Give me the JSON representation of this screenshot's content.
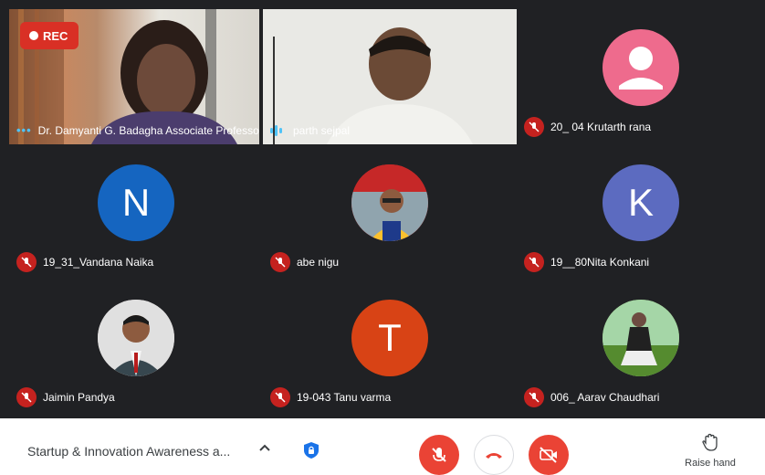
{
  "recording": {
    "label": "REC"
  },
  "tiles": [
    {
      "name": "Dr. Damyanti G. Badagha Associate Professor",
      "state": "speaking-dots"
    },
    {
      "name": "parth sejpal",
      "state": "speaking-bars"
    },
    {
      "name": "20_ 04 Krutarth rana",
      "state": "muted",
      "avatar": "person-icon",
      "avatar_color": "#ee6b8d"
    },
    {
      "name": "19_31_Vandana Naika",
      "state": "muted",
      "avatar_letter": "N",
      "avatar_color": "#1565c0"
    },
    {
      "name": "abe nigu",
      "state": "muted",
      "avatar": "photo"
    },
    {
      "name": "19__80Nita Konkani",
      "state": "muted",
      "avatar_letter": "K",
      "avatar_color": "#5c6bc0"
    },
    {
      "name": "Jaimin Pandya",
      "state": "muted",
      "avatar": "photo"
    },
    {
      "name": "19-043 Tanu varma",
      "state": "muted",
      "avatar_letter": "T",
      "avatar_color": "#d84315"
    },
    {
      "name": "006_ Aarav Chaudhari",
      "state": "muted",
      "avatar": "photo"
    }
  ],
  "footer": {
    "meeting_title": "Startup & Innovation Awareness a...",
    "raise_hand_label": "Raise hand"
  },
  "colors": {
    "accent_red": "#ea4335",
    "rec_red": "#d93025",
    "speaking": "#4fc3f7"
  }
}
